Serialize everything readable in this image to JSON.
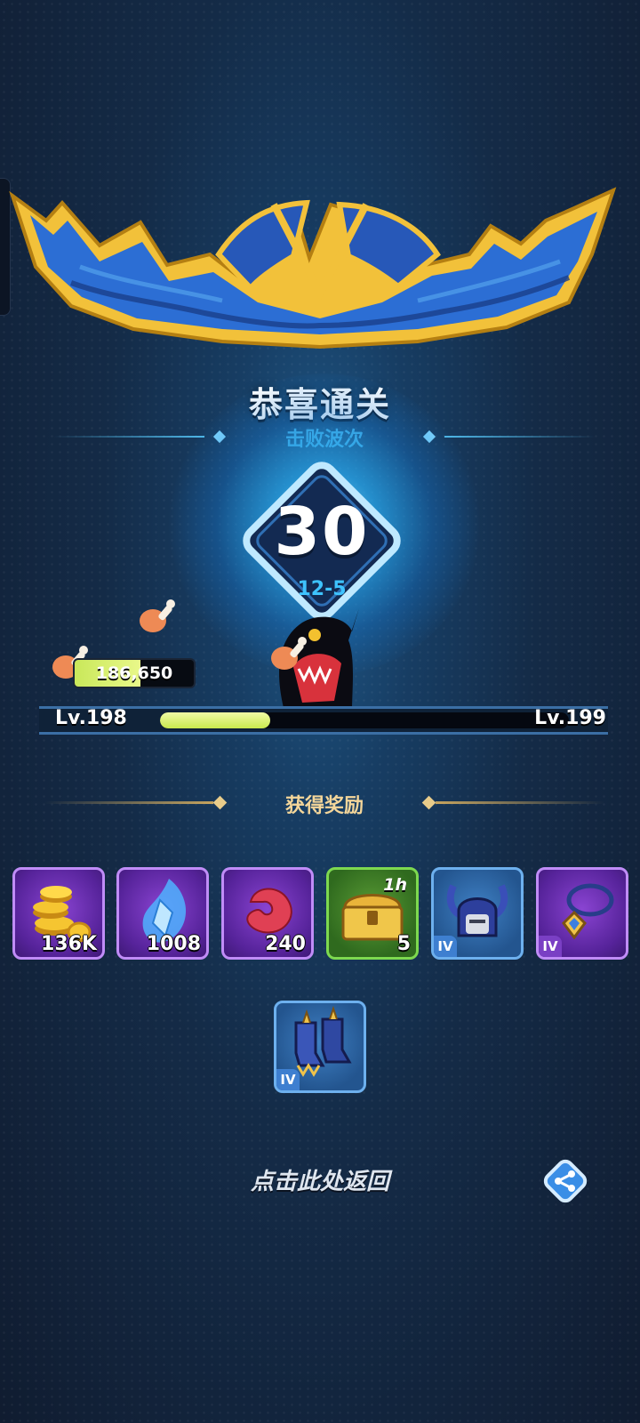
{
  "header": {
    "title": "恭喜通关",
    "subtitle": "击败波次"
  },
  "wave": {
    "number": "30",
    "stage": "12-5"
  },
  "exp_counter": {
    "value": "186,650",
    "fill": 0.55
  },
  "level": {
    "current": "Lv.198",
    "next": "Lv.199",
    "progress": 0.27
  },
  "rewards": {
    "title": "获得奖励",
    "items": [
      {
        "icon": "gold-coins-icon",
        "qty": "136K",
        "tier": "",
        "timer": "",
        "rarity": "purple"
      },
      {
        "icon": "blue-crystal-icon",
        "qty": "1008",
        "tier": "",
        "timer": "",
        "rarity": "purple"
      },
      {
        "icon": "red-bean-icon",
        "qty": "240",
        "tier": "",
        "timer": "",
        "rarity": "purple"
      },
      {
        "icon": "treasure-chest-icon",
        "qty": "5",
        "tier": "",
        "timer": "1h",
        "rarity": "green"
      },
      {
        "icon": "horned-helmet-icon",
        "qty": "",
        "tier": "IV",
        "timer": "",
        "rarity": "blue"
      },
      {
        "icon": "gem-necklace-icon",
        "qty": "",
        "tier": "IV",
        "timer": "",
        "rarity": "purple"
      },
      {
        "icon": "armored-boots-icon",
        "qty": "",
        "tier": "IV",
        "timer": "",
        "rarity": "blue"
      }
    ]
  },
  "footer": {
    "return_label": "点击此处返回"
  },
  "colors": {
    "accent": "#49b8ea",
    "gold": "#f4d69a",
    "exp_bar": "#d7f070"
  }
}
